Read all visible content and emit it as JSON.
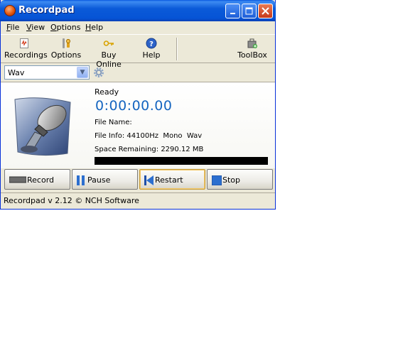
{
  "window": {
    "title": "Recordpad"
  },
  "menu": {
    "items": [
      {
        "ul": "F",
        "rest": "ile"
      },
      {
        "ul": "V",
        "rest": "iew"
      },
      {
        "ul": "O",
        "rest": "ptions"
      },
      {
        "ul": "H",
        "rest": "elp"
      }
    ]
  },
  "toolbar": {
    "recordings": "Recordings",
    "options": "Options",
    "buy_online": "Buy Online",
    "help": "Help",
    "toolbox": "ToolBox"
  },
  "format": {
    "selected": "Wav"
  },
  "status": {
    "state": "Ready",
    "time": "0:00:00.00",
    "file_name_label": "File Name:",
    "file_name": "",
    "file_info_label": "File Info:",
    "file_info": "44100Hz  Mono  Wav",
    "space_label": "Space Remaining:",
    "space": "2290.12 MB"
  },
  "buttons": {
    "record": "Record",
    "pause": "Pause",
    "restart": "Restart",
    "stop": "Stop"
  },
  "statusbar": {
    "text": "Recordpad v 2.12 © NCH Software"
  },
  "colors": {
    "timer": "#1565c0",
    "titlebar": "#0654d6"
  }
}
